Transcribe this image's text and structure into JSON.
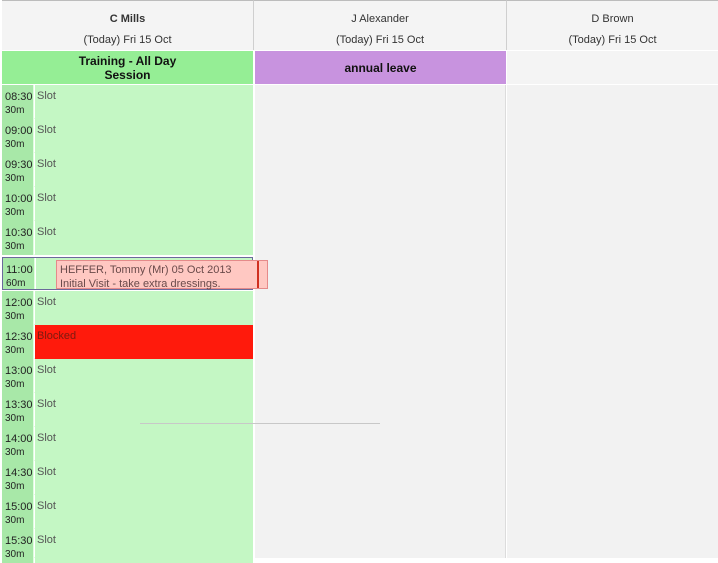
{
  "columns": [
    {
      "name": "C Mills",
      "date": "(Today) Fri 15 Oct"
    },
    {
      "name": "J Alexander",
      "date": "(Today) Fri 15 Oct"
    },
    {
      "name": "D Brown",
      "date": "(Today) Fri 15 Oct"
    }
  ],
  "allday": {
    "training_line1": "Training - All Day",
    "training_line2": "Session",
    "leave": "annual leave"
  },
  "slots": [
    {
      "time": "08:30",
      "dur": "30m",
      "label": "Slot"
    },
    {
      "time": "09:00",
      "dur": "30m",
      "label": "Slot"
    },
    {
      "time": "09:30",
      "dur": "30m",
      "label": "Slot"
    },
    {
      "time": "10:00",
      "dur": "30m",
      "label": "Slot"
    },
    {
      "time": "10:30",
      "dur": "30m",
      "label": "Slot"
    },
    {
      "time": "11:00",
      "dur": "60m",
      "appt_line1": "HEFFER, Tommy (Mr) 05 Oct 2013",
      "appt_line2": "Initial Visit - take extra dressings."
    },
    {
      "time": "12:00",
      "dur": "30m",
      "label": "Slot"
    },
    {
      "time": "12:30",
      "dur": "30m",
      "label": "Blocked"
    },
    {
      "time": "13:00",
      "dur": "30m",
      "label": "Slot"
    },
    {
      "time": "13:30",
      "dur": "30m",
      "label": "Slot"
    },
    {
      "time": "14:00",
      "dur": "30m",
      "label": "Slot"
    },
    {
      "time": "14:30",
      "dur": "30m",
      "label": "Slot"
    },
    {
      "time": "15:00",
      "dur": "30m",
      "label": "Slot"
    },
    {
      "time": "15:30",
      "dur": "30m",
      "label": "Slot"
    }
  ],
  "colors": {
    "training": "#95ee95",
    "leave": "#c893df",
    "slot": "#c4f7c4",
    "blocked": "#ff1a0c",
    "appointment": "#ffc8c2"
  }
}
